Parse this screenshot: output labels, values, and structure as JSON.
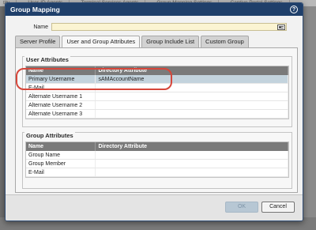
{
  "background_tabs": [
    "tity",
    "User-ID Agents",
    "Terminal Services Agents",
    "Group Mapping Settings",
    "Captive Portal Settings"
  ],
  "dialog": {
    "title": "Group Mapping",
    "name_label": "Name",
    "name_value": ""
  },
  "tabs": [
    {
      "label": "Server Profile",
      "active": false
    },
    {
      "label": "User and Group Attributes",
      "active": true
    },
    {
      "label": "Group Include List",
      "active": false
    },
    {
      "label": "Custom Group",
      "active": false
    }
  ],
  "user_attributes": {
    "legend": "User Attributes",
    "columns": [
      "Name",
      "Directory Attribute"
    ],
    "rows": [
      {
        "name": "Primary Username",
        "attribute": "sAMAccountName",
        "selected": true
      },
      {
        "name": "E-Mail",
        "attribute": ""
      },
      {
        "name": "Alternate Username 1",
        "attribute": ""
      },
      {
        "name": "Alternate Username 2",
        "attribute": ""
      },
      {
        "name": "Alternate Username 3",
        "attribute": ""
      }
    ]
  },
  "group_attributes": {
    "legend": "Group Attributes",
    "columns": [
      "Name",
      "Directory Attribute"
    ],
    "rows": [
      {
        "name": "Group Name",
        "attribute": ""
      },
      {
        "name": "Group Member",
        "attribute": ""
      },
      {
        "name": "E-Mail",
        "attribute": ""
      }
    ]
  },
  "buttons": {
    "ok": "OK",
    "cancel": "Cancel"
  },
  "colors": {
    "titlebar": "#1f3f6a",
    "header_row": "#7a7a7a",
    "selected_row": "#c3d3dd",
    "highlight_ring": "#d6463a",
    "name_input_bg": "#fbf4d2"
  },
  "icons": {
    "help": "help-icon",
    "name_field": "address-card-icon"
  }
}
